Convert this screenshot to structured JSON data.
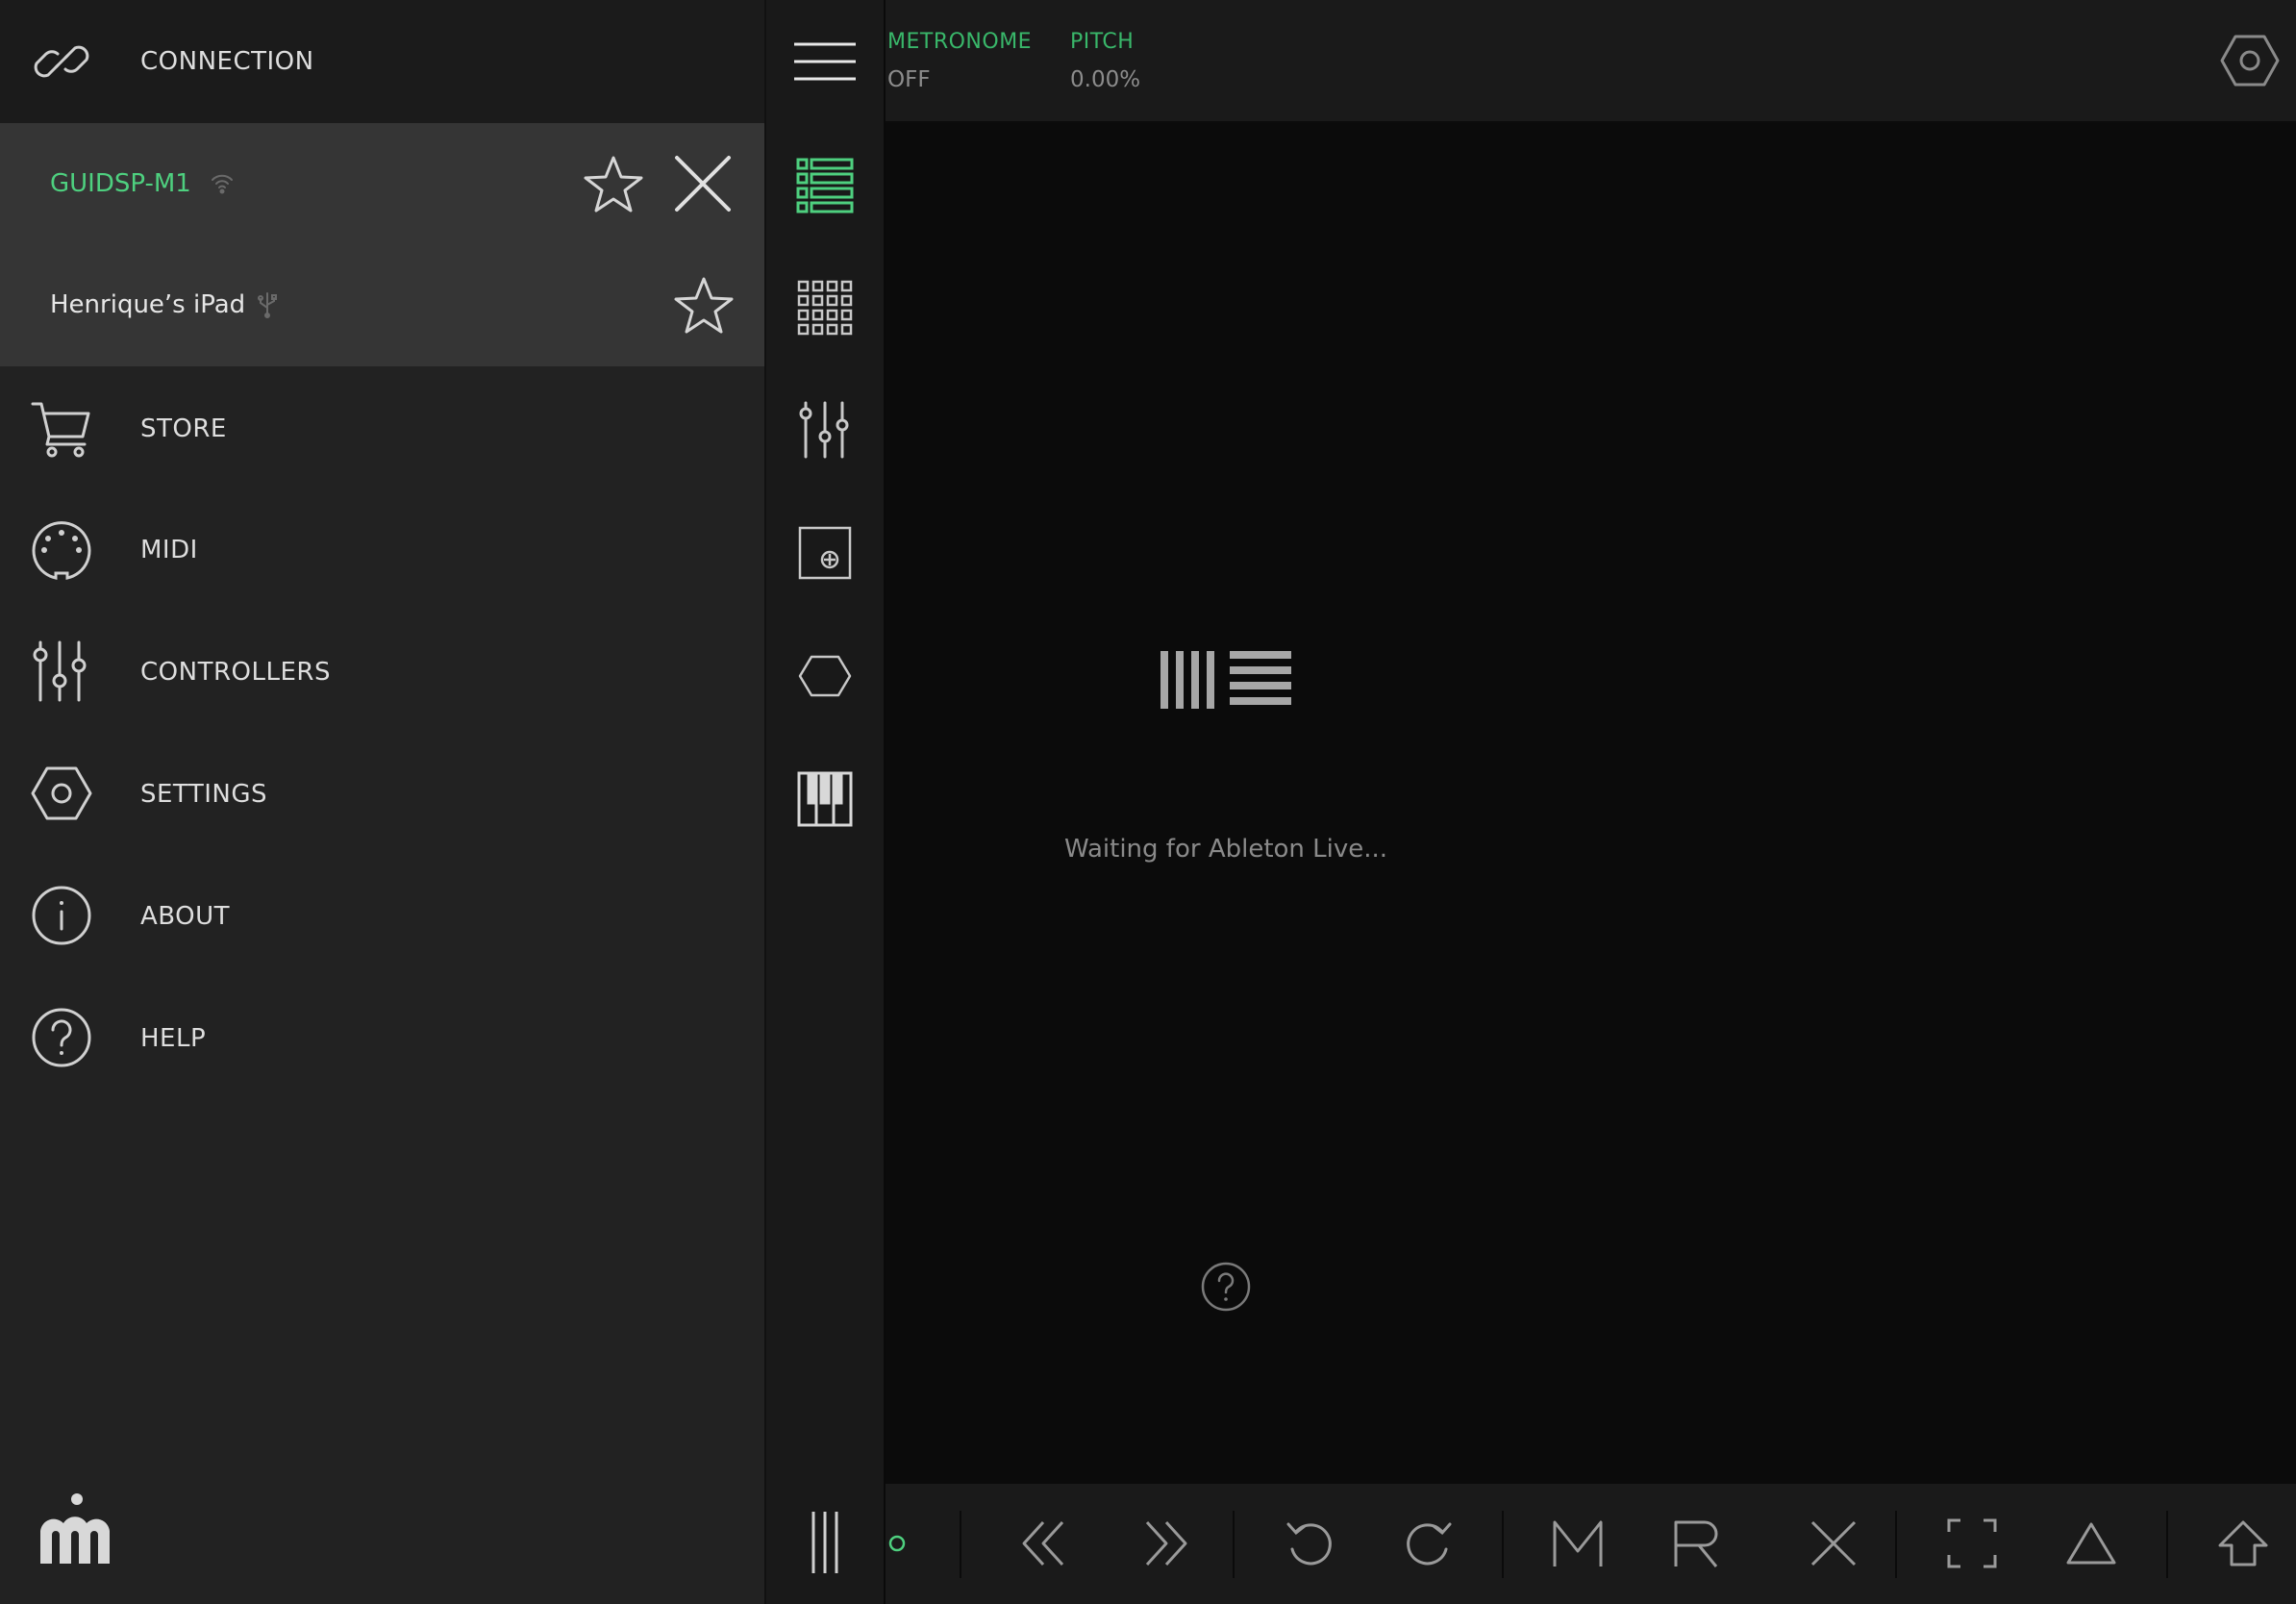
{
  "drawer": {
    "connection_label": "CONNECTION",
    "devices": [
      {
        "name": "GUIDSP-M1",
        "color": "#4ed07f",
        "connection": "wifi-icon",
        "favorite": false,
        "connected": true
      },
      {
        "name": "Henrique’s iPad",
        "color": "#e6e6e6",
        "connection": "usb-icon",
        "favorite": false,
        "connected": false
      }
    ],
    "menu": [
      {
        "label": "STORE",
        "icon": "cart-icon"
      },
      {
        "label": "MIDI",
        "icon": "midi-port-icon"
      },
      {
        "label": "CONTROLLERS",
        "icon": "sliders-icon"
      },
      {
        "label": "SETTINGS",
        "icon": "hexagon-settings-icon"
      },
      {
        "label": "ABOUT",
        "icon": "info-icon"
      },
      {
        "label": "HELP",
        "icon": "help-icon"
      }
    ]
  },
  "tools": [
    "menu-icon",
    "session-view-icon",
    "pad-grid-icon",
    "mixer-icon",
    "device-icon",
    "instrument-hexagon-icon",
    "keyboard-icon"
  ],
  "topbar": {
    "metronome_label": "METRONOME",
    "metronome_value": "OFF",
    "pitch_label": "PITCH",
    "pitch_value": "0.00%"
  },
  "main": {
    "status_text": "Waiting for Ableton Live..."
  },
  "bottombar": {
    "buttons": [
      "loop-icon",
      "rewind-icon",
      "fast-forward-icon",
      "undo-icon",
      "redo-icon",
      "M",
      "R",
      "delete-icon",
      "fullscreen-icon",
      "triangle-icon",
      "shift-icon"
    ]
  },
  "colors": {
    "accent": "#4ed07f",
    "drawer_bg": "#222222",
    "device_bg": "#353535",
    "main_bg": "#0b0b0b"
  }
}
